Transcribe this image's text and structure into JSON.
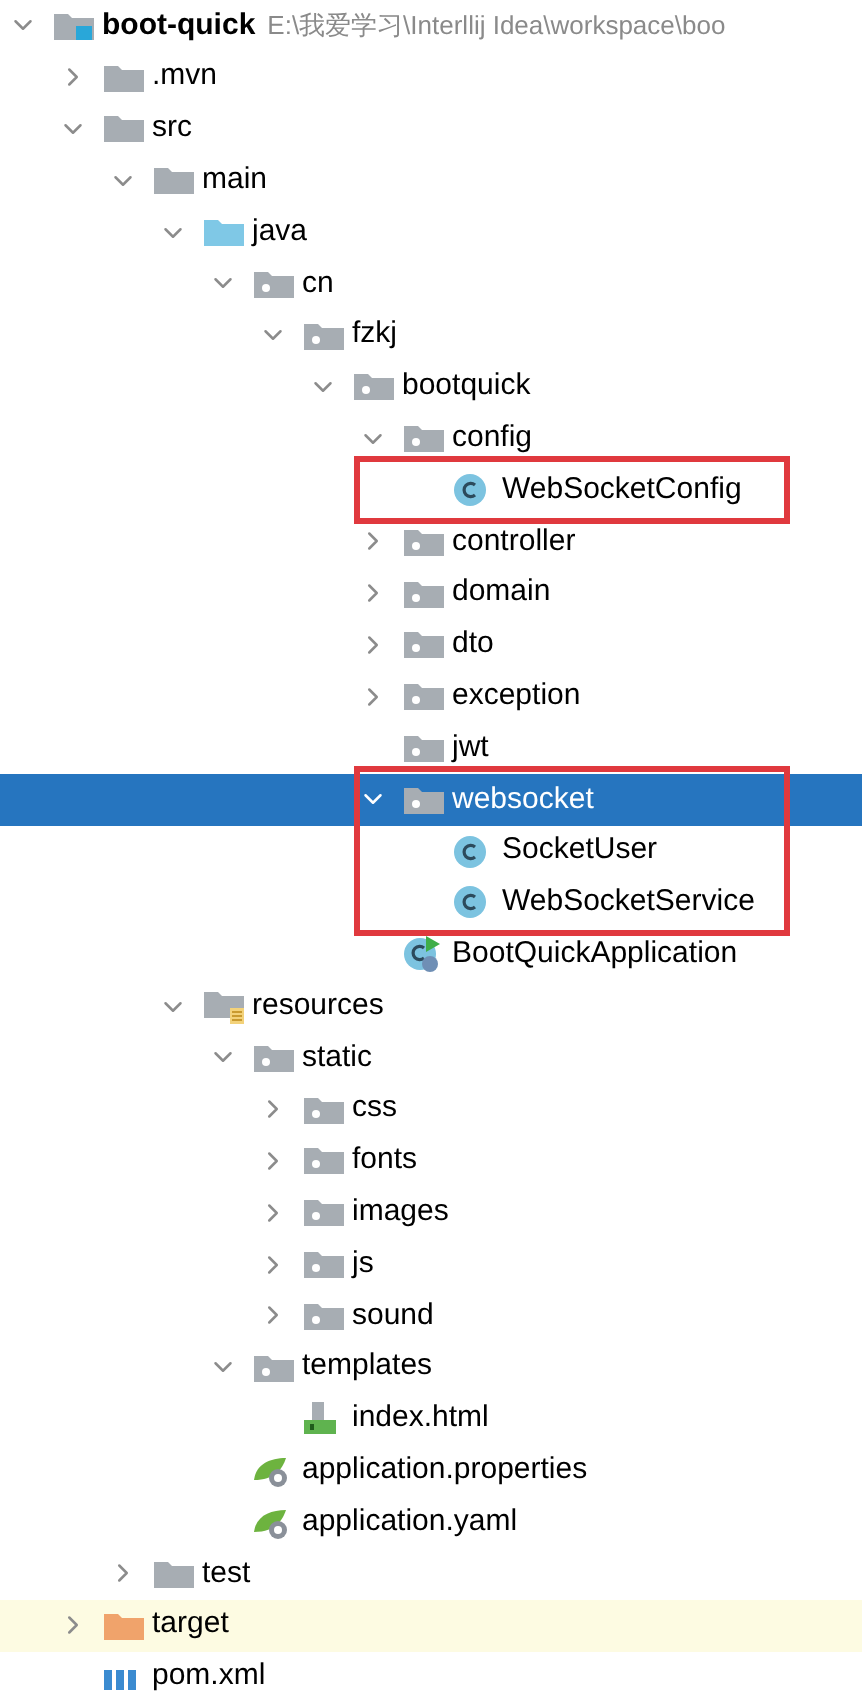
{
  "project_tree": {
    "root": {
      "name": "boot-quick",
      "path": "E:\\我爱学习\\Interllij Idea\\workspace\\boo",
      "kind": "module",
      "expanded": true,
      "selected": false,
      "outlined": false,
      "children": [
        {
          "name": ".mvn",
          "kind": "folder",
          "expanded": false,
          "selected": false,
          "outlined": false
        },
        {
          "name": "src",
          "kind": "folder",
          "expanded": true,
          "selected": false,
          "outlined": false,
          "children": [
            {
              "name": "main",
              "kind": "folder",
              "expanded": true,
              "selected": false,
              "outlined": false,
              "children": [
                {
                  "name": "java",
                  "kind": "source-folder",
                  "expanded": true,
                  "selected": false,
                  "outlined": false,
                  "children": [
                    {
                      "name": "cn",
                      "kind": "package",
                      "expanded": true,
                      "selected": false,
                      "outlined": false,
                      "children": [
                        {
                          "name": "fzkj",
                          "kind": "package",
                          "expanded": true,
                          "selected": false,
                          "outlined": false,
                          "children": [
                            {
                              "name": "bootquick",
                              "kind": "package",
                              "expanded": true,
                              "selected": false,
                              "outlined": false,
                              "children": [
                                {
                                  "name": "config",
                                  "kind": "package",
                                  "expanded": true,
                                  "selected": false,
                                  "outlined": false,
                                  "children": [
                                    {
                                      "name": "WebSocketConfig",
                                      "kind": "class",
                                      "selected": false,
                                      "outlined": true
                                    }
                                  ]
                                },
                                {
                                  "name": "controller",
                                  "kind": "package",
                                  "expanded": false,
                                  "selected": false,
                                  "outlined": false
                                },
                                {
                                  "name": "domain",
                                  "kind": "package",
                                  "expanded": false,
                                  "selected": false,
                                  "outlined": false
                                },
                                {
                                  "name": "dto",
                                  "kind": "package",
                                  "expanded": false,
                                  "selected": false,
                                  "outlined": false
                                },
                                {
                                  "name": "exception",
                                  "kind": "package",
                                  "expanded": false,
                                  "selected": false,
                                  "outlined": false
                                },
                                {
                                  "name": "jwt",
                                  "kind": "package",
                                  "selected": false,
                                  "outlined": false
                                },
                                {
                                  "name": "websocket",
                                  "kind": "package",
                                  "expanded": true,
                                  "selected": true,
                                  "outlined": true,
                                  "children": [
                                    {
                                      "name": "SocketUser",
                                      "kind": "class",
                                      "selected": false,
                                      "outlined": true
                                    },
                                    {
                                      "name": "WebSocketService",
                                      "kind": "class",
                                      "selected": false,
                                      "outlined": true
                                    }
                                  ]
                                },
                                {
                                  "name": "BootQuickApplication",
                                  "kind": "app-class",
                                  "selected": false,
                                  "outlined": false
                                }
                              ]
                            }
                          ]
                        }
                      ]
                    }
                  ]
                },
                {
                  "name": "resources",
                  "kind": "resources-folder",
                  "expanded": true,
                  "selected": false,
                  "outlined": false,
                  "children": [
                    {
                      "name": "static",
                      "kind": "package",
                      "expanded": true,
                      "selected": false,
                      "outlined": false,
                      "children": [
                        {
                          "name": "css",
                          "kind": "package",
                          "expanded": false,
                          "selected": false,
                          "outlined": false
                        },
                        {
                          "name": "fonts",
                          "kind": "package",
                          "expanded": false,
                          "selected": false,
                          "outlined": false
                        },
                        {
                          "name": "images",
                          "kind": "package",
                          "expanded": false,
                          "selected": false,
                          "outlined": false
                        },
                        {
                          "name": "js",
                          "kind": "package",
                          "expanded": false,
                          "selected": false,
                          "outlined": false
                        },
                        {
                          "name": "sound",
                          "kind": "package",
                          "expanded": false,
                          "selected": false,
                          "outlined": false
                        }
                      ]
                    },
                    {
                      "name": "templates",
                      "kind": "package",
                      "expanded": true,
                      "selected": false,
                      "outlined": false,
                      "children": [
                        {
                          "name": "index.html",
                          "kind": "html",
                          "selected": false,
                          "outlined": false
                        }
                      ]
                    },
                    {
                      "name": "application.properties",
                      "kind": "spring-config",
                      "selected": false,
                      "outlined": false
                    },
                    {
                      "name": "application.yaml",
                      "kind": "spring-config",
                      "selected": false,
                      "outlined": false
                    }
                  ]
                }
              ]
            },
            {
              "name": "test",
              "kind": "folder",
              "expanded": false,
              "selected": false,
              "outlined": false
            }
          ]
        },
        {
          "name": "target",
          "kind": "excluded-folder",
          "expanded": false,
          "selected": false,
          "outlined": false
        },
        {
          "name": "pom.xml",
          "kind": "maven",
          "selected": false,
          "outlined": false
        }
      ]
    }
  }
}
